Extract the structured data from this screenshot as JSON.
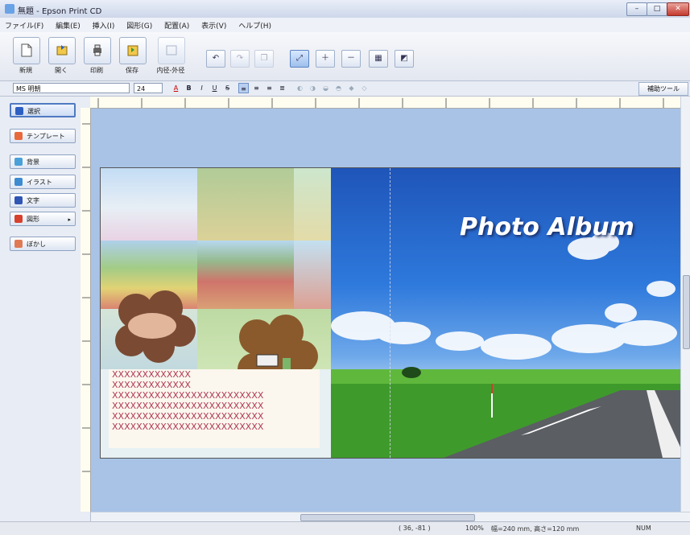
{
  "window": {
    "title": "無題 - Epson Print CD",
    "min": "–",
    "max": "□",
    "close": "✕"
  },
  "menu": [
    "ファイル(F)",
    "編集(E)",
    "挿入(I)",
    "図形(G)",
    "配置(A)",
    "表示(V)",
    "ヘルプ(H)"
  ],
  "toolbar": {
    "big_buttons": [
      {
        "label": "新規",
        "icon": "new-document-icon"
      },
      {
        "label": "開く",
        "icon": "open-folder-icon"
      },
      {
        "label": "印刷",
        "icon": "printer-icon"
      },
      {
        "label": "保存",
        "icon": "save-icon"
      },
      {
        "label": "内径-外径",
        "icon": "diameter-icon"
      }
    ],
    "small_buttons": [
      "undo-icon",
      "redo-icon",
      "copy-icon",
      "fit-page-icon",
      "zoom-in-icon",
      "zoom-out-icon",
      "grid-icon",
      "layout-icon"
    ]
  },
  "format": {
    "font": "MS 明朝",
    "size": "24",
    "buttons": [
      "A",
      "B",
      "I",
      "U",
      "S"
    ],
    "helper": "補助ツール"
  },
  "left_panel": [
    {
      "label": "選択",
      "icon": "select-arrow-icon",
      "selected": true
    },
    {
      "label": "テンプレート",
      "icon": "template-icon"
    },
    {
      "label": "背景",
      "icon": "background-icon"
    },
    {
      "label": "イラスト",
      "icon": "illustration-icon"
    },
    {
      "label": "文字",
      "icon": "text-icon"
    },
    {
      "label": "図形",
      "icon": "shape-icon",
      "has_menu": true
    },
    {
      "label": "ぼかし",
      "icon": "blur-icon"
    }
  ],
  "canvas": {
    "title": "Photo Album",
    "text_lines": [
      "XXXXXXXXXXXXX",
      "XXXXXXXXXXXXX",
      "XXXXXXXXXXXXXXXXXXXXXXXXX",
      "XXXXXXXXXXXXXXXXXXXXXXXXX",
      "XXXXXXXXXXXXXXXXXXXXXXXXX",
      "XXXXXXXXXXXXXXXXXXXXXXXXX"
    ]
  },
  "status": {
    "coords": "( 36, -81 )",
    "zoom": "100%",
    "dims": "幅=240 mm, 高さ=120 mm",
    "num": "NUM"
  },
  "colors": {
    "workspace": "#a8c3e6",
    "text_red": "#b03a55"
  }
}
